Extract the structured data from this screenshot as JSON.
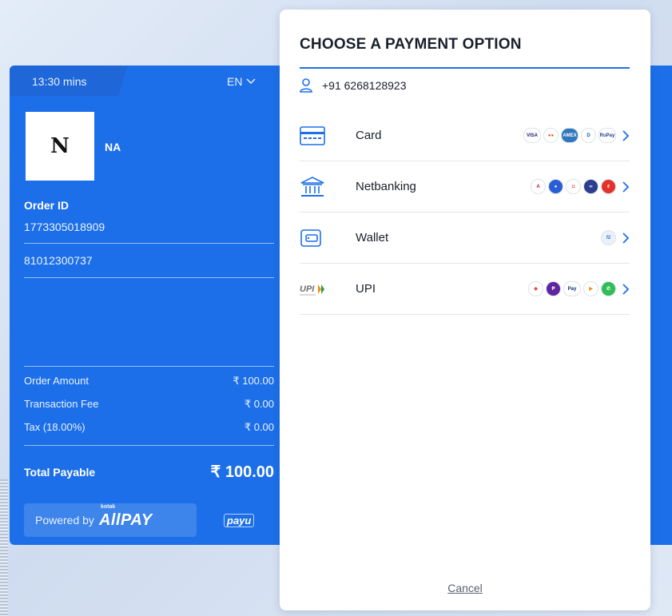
{
  "left": {
    "timer": "13:30 mins",
    "language": "EN",
    "logo_letter": "N",
    "merchant_name": "NA",
    "order_id_label": "Order ID",
    "order_id_value": "1773305018909",
    "reference_value": "81012300737",
    "summary": [
      {
        "label": "Order Amount",
        "value": "₹ 100.00"
      },
      {
        "label": "Transaction Fee",
        "value": "₹ 0.00"
      },
      {
        "label": "Tax (18.00%)",
        "value": "₹ 0.00"
      }
    ],
    "total_label": "Total Payable",
    "total_value": "₹ 100.00",
    "powered_by": "Powered by",
    "brand_small": "kotak",
    "brand_main": "AllPAY",
    "partner_logo": "payu"
  },
  "card": {
    "title": "CHOOSE A PAYMENT OPTION",
    "phone": "+91 6268128923",
    "options": [
      {
        "label": "Card",
        "icon": "card-icon",
        "logos": [
          {
            "name": "visa",
            "text": "VISA",
            "color": "#1a1f71",
            "bg": "#ffffff"
          },
          {
            "name": "mastercard",
            "text": "●●",
            "color": "#eb5a1c",
            "bg": "#ffffff"
          },
          {
            "name": "amex",
            "text": "AMEX",
            "color": "#ffffff",
            "bg": "#2e77bc"
          },
          {
            "name": "diners",
            "text": "D",
            "color": "#0b5fa8",
            "bg": "#ffffff"
          },
          {
            "name": "rupay",
            "text": "RuPay",
            "color": "#1b3f8b",
            "bg": "#ffffff"
          }
        ]
      },
      {
        "label": "Netbanking",
        "icon": "bank-icon",
        "logos": [
          {
            "name": "axis",
            "text": "A",
            "color": "#a7144c",
            "bg": "#ffffff"
          },
          {
            "name": "sbi",
            "text": "●",
            "color": "#ffffff",
            "bg": "#2a5ed6"
          },
          {
            "name": "icici",
            "text": "◘",
            "color": "#e0322b",
            "bg": "#ffffff"
          },
          {
            "name": "kotak",
            "text": "∞",
            "color": "#ffffff",
            "bg": "#2b3f8e"
          },
          {
            "name": "hdfc",
            "text": "ℓ",
            "color": "#ffffff",
            "bg": "#e4322b"
          }
        ]
      },
      {
        "label": "Wallet",
        "icon": "wallet-icon",
        "logos": [
          {
            "name": "freecharge",
            "text": "f2",
            "color": "#2e6fd0",
            "bg": "#eaf1fb"
          }
        ]
      },
      {
        "label": "UPI",
        "icon": "upi-icon",
        "logos": [
          {
            "name": "google-pay",
            "text": "◆",
            "color": "#e8463b",
            "bg": "#ffffff"
          },
          {
            "name": "phonepe",
            "text": "₱",
            "color": "#ffffff",
            "bg": "#5f259f"
          },
          {
            "name": "paytm",
            "text": "Pay",
            "color": "#0a2b6e",
            "bg": "#ffffff"
          },
          {
            "name": "bhim",
            "text": "▶",
            "color": "#f28c1e",
            "bg": "#ffffff"
          },
          {
            "name": "whatsapp",
            "text": "✆",
            "color": "#ffffff",
            "bg": "#2fbe55"
          }
        ]
      }
    ],
    "cancel_label": "Cancel"
  }
}
